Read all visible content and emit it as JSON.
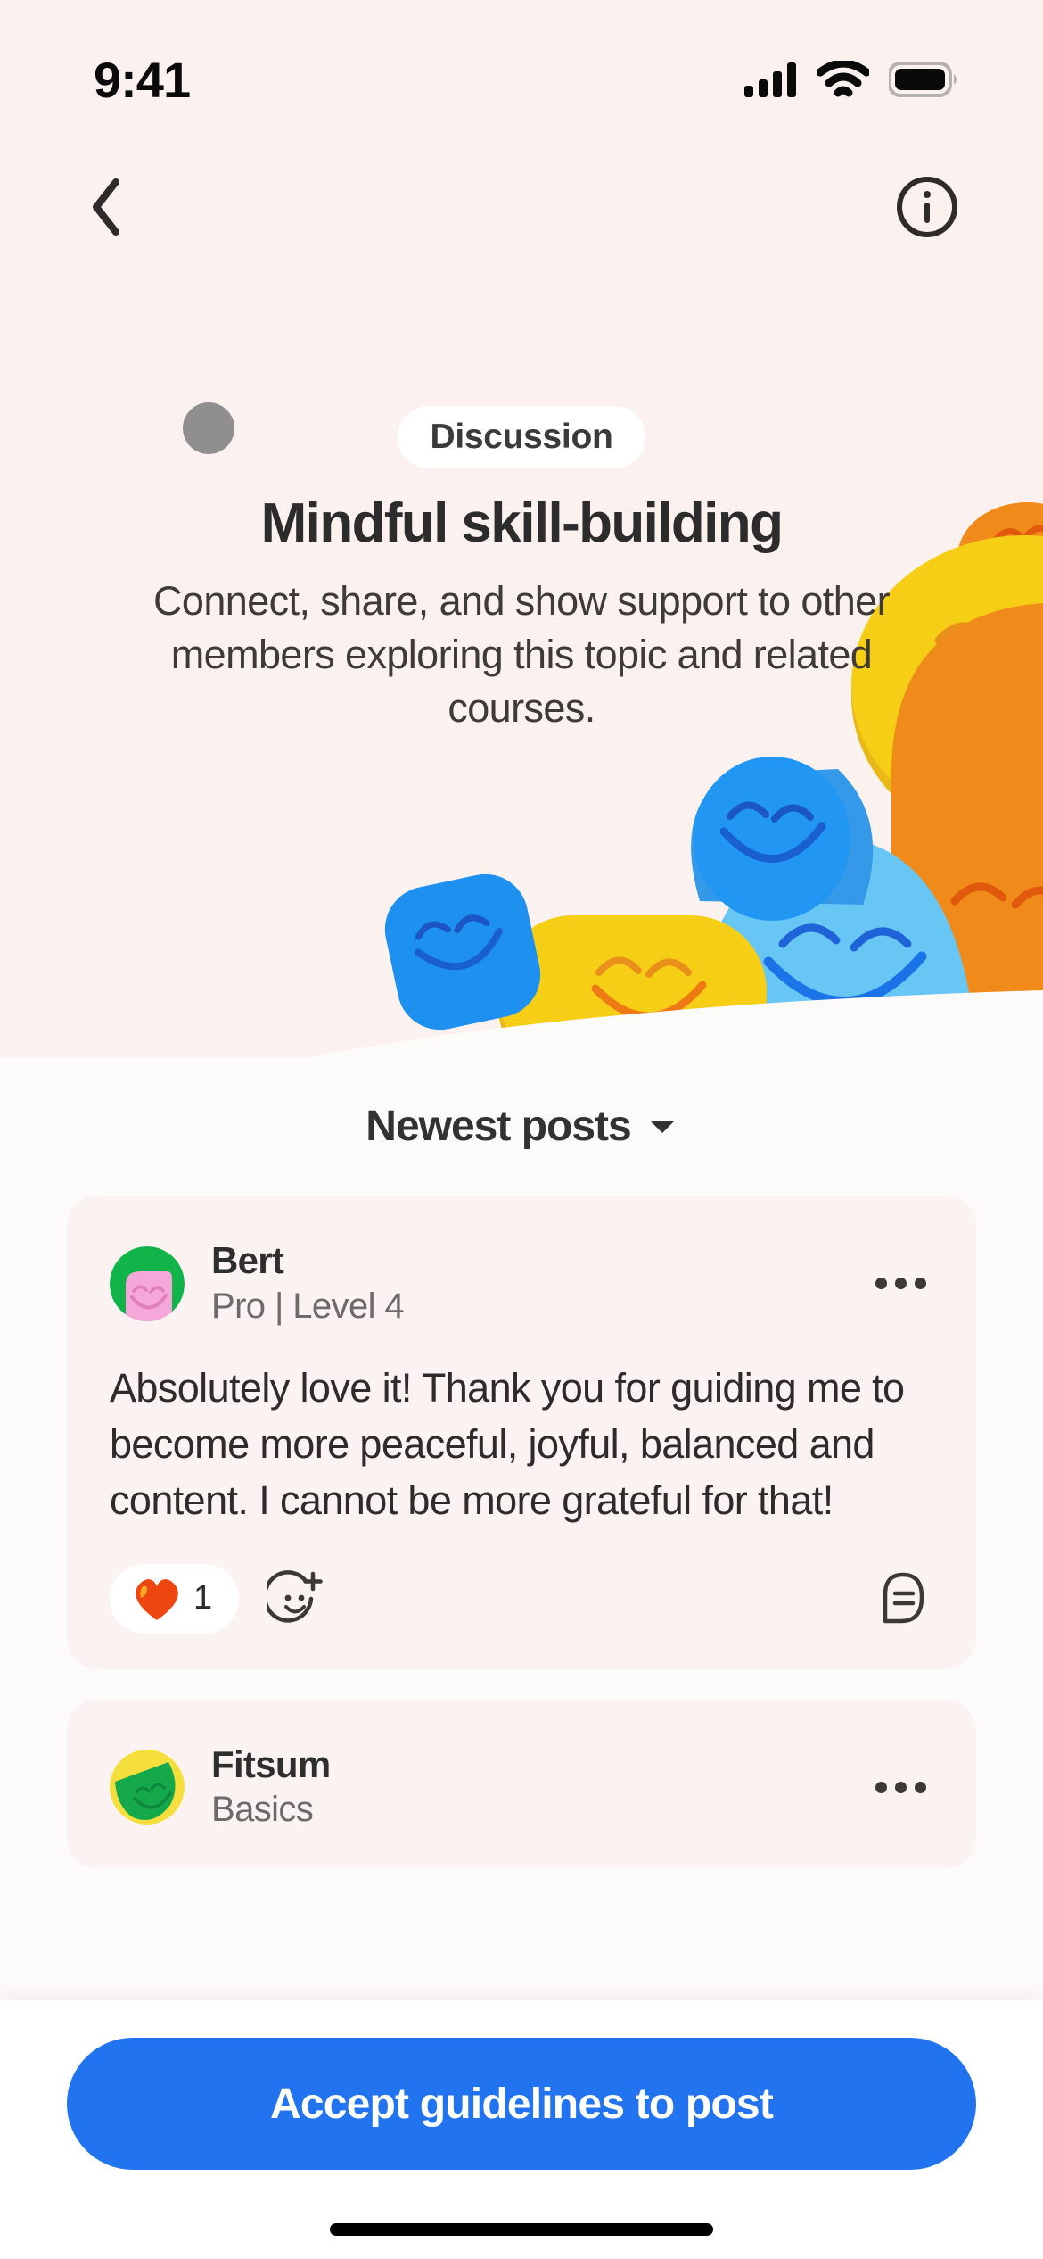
{
  "status_bar": {
    "time": "9:41",
    "cellular_icon": "cellular-signal-icon",
    "wifi_icon": "wifi-icon",
    "battery_icon": "battery-full-icon"
  },
  "nav": {
    "back_icon": "chevron-left-icon",
    "info_icon": "info-circle-icon"
  },
  "hero": {
    "badge": "Discussion",
    "title": "Mindful skill-building",
    "description": "Connect, share, and show support to other members exploring this topic and related courses.",
    "colors": {
      "background": "#FBF2F0",
      "blue": "#1E90F0",
      "light_blue": "#68C6F5",
      "yellow": "#F7CE16",
      "orange": "#F08A1A",
      "wave": "#FDFBFA"
    }
  },
  "sort": {
    "label": "Newest posts",
    "chevron_icon": "chevron-down-icon"
  },
  "posts": [
    {
      "author": "Bert",
      "subtitle": "Pro | Level 4",
      "body": "Absolutely love it! Thank you for guiding me to become more peaceful, joyful, balanced and content. I cannot be more grateful for that!",
      "avatar": {
        "ring": "#11B449",
        "face": "#F4A7D8"
      },
      "reaction": {
        "icon": "heart-icon",
        "count": "1",
        "color": "#EE4611"
      },
      "add_reaction_icon": "add-emoji-icon",
      "comment_icon": "comment-bubble-icon",
      "menu_icon": "more-options-icon"
    },
    {
      "author": "Fitsum",
      "subtitle": "Basics",
      "avatar": {
        "ring": "#F5DF3C",
        "face": "#16A94C"
      },
      "menu_icon": "more-options-icon"
    }
  ],
  "bottom": {
    "cta_label": "Accept guidelines to post",
    "cta_color": "#2173EF"
  }
}
